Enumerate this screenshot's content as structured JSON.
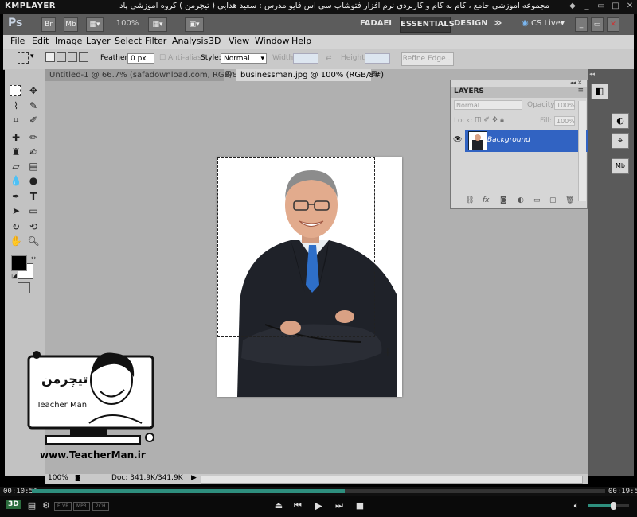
{
  "kmplayer": {
    "logo": "KMPLAYER",
    "caption": "مجموعه آموزشی جامع ، گام به گام و کاربردی نرم افزار فتوشاپ سی اس فایو  مدرس : سعید هدایی ( تیچرمن ) گروه آموزشی پادشاه گرافیست ها",
    "time_elapsed": "00:10:51",
    "time_total": "00:19:52",
    "pills": [
      "FLVR",
      "MP3",
      "2CH"
    ],
    "badge": "3D",
    "progress_fraction": 0.546
  },
  "appbar": {
    "logo": "Ps",
    "br": "Br",
    "mb": "Mb",
    "zoom": "100%",
    "workspaces": [
      "FADAEI",
      "ESSENTIALS",
      "DESIGN"
    ],
    "more": "≫",
    "cs_live": "CS Live"
  },
  "menu": [
    "File",
    "Edit",
    "Image",
    "Layer",
    "Select",
    "Filter",
    "Analysis",
    "3D",
    "View",
    "Window",
    "Help"
  ],
  "options": {
    "feather_label": "Feather:",
    "feather_value": "0 px",
    "antialias_label": "Anti-alias",
    "style_label": "Style:",
    "style_value": "Normal",
    "width_label": "Width:",
    "height_label": "Height:",
    "refine_label": "Refine Edge..."
  },
  "tabs": [
    {
      "label": "Untitled-1 @ 66.7% (safadownload.com, RGB/8) *",
      "active": false
    },
    {
      "label": "businessman.jpg @ 100% (RGB/8#)",
      "active": true
    }
  ],
  "layers_panel": {
    "title": "LAYERS",
    "blend_mode": "Normal",
    "opacity_label": "Opacity:",
    "opacity_value": "100%",
    "lock_label": "Lock:",
    "fill_label": "Fill:",
    "fill_value": "100%",
    "layer_name": "Background",
    "footer_icons": [
      "link-icon",
      "fx-icon",
      "mask-icon",
      "adjustment-icon",
      "group-icon",
      "new-layer-icon",
      "trash-icon"
    ]
  },
  "status": {
    "zoom": "100%",
    "doc_info": "Doc: 341.9K/341.9K"
  },
  "watermark": {
    "url": "www.TeacherMan.ir",
    "brand_fa": "تیچرمن",
    "brand_en": "Teacher Man"
  },
  "colors": {
    "foreground": "#000000",
    "background": "#ffffff",
    "layer_highlight": "#3163c2",
    "suit": "#1f2229",
    "tie": "#2e6fc9"
  }
}
